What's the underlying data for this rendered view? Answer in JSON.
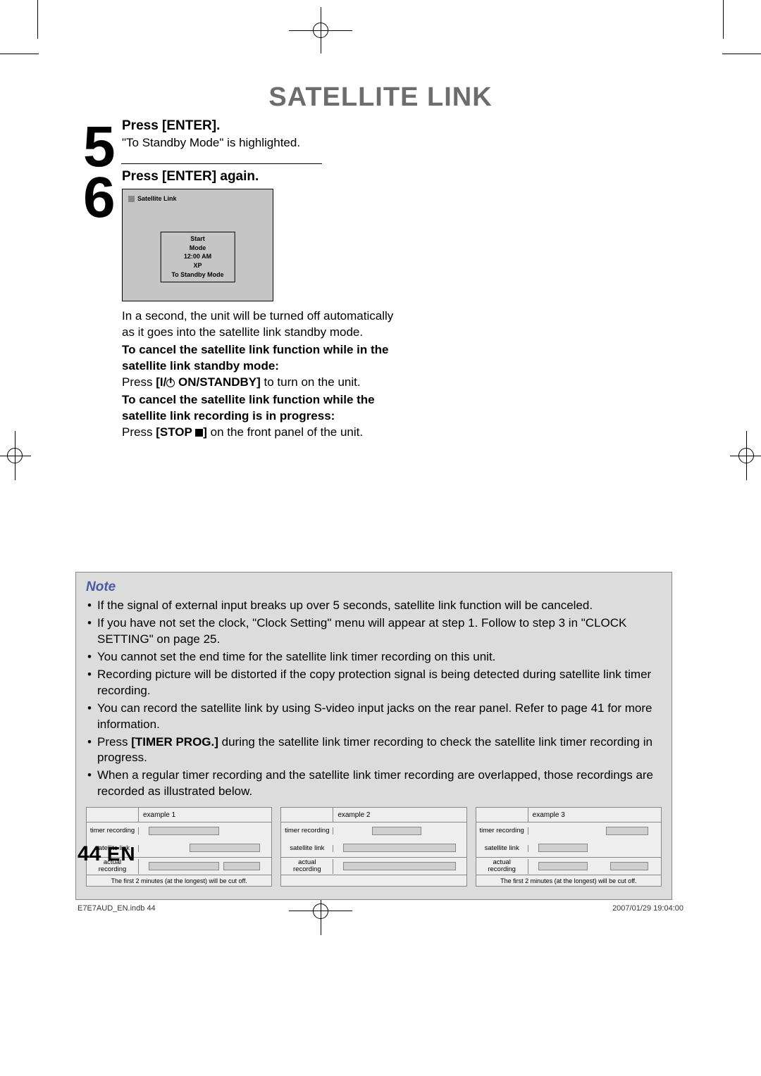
{
  "title": "SATELLITE LINK",
  "step5": {
    "num": "5",
    "head": "Press [ENTER].",
    "text": "\"To Standby Mode\" is highlighted."
  },
  "step6": {
    "num": "6",
    "head": "Press [ENTER] again.",
    "screen": {
      "title": "Satellite Link",
      "col1": "Start",
      "col2": "Mode",
      "val1": "12:00 AM",
      "val2": "XP",
      "row3": "To Standby Mode"
    },
    "p1": "In a second, the unit will be turned off automatically as it goes into the satellite link standby mode.",
    "b1": "To cancel the satellite link function while in the satellite link standby mode:",
    "p2a": "Press ",
    "p2b": "[I/",
    "p2c": " ON/STANDBY]",
    "p2d": " to turn on the unit.",
    "b2": "To cancel the satellite link function while the satellite link recording is in progress:",
    "p3a": "Press ",
    "p3b": "[STOP ",
    "p3c": "]",
    "p3d": " on the front panel of the unit."
  },
  "note": {
    "title": "Note",
    "items": [
      "If the signal of external input breaks up over 5 seconds, satellite link function will be canceled.",
      "If you have not set the clock, \"Clock Setting\" menu will appear at step 1. Follow to step 3 in \"CLOCK SETTING\" on page 25.",
      "You cannot set the end time for the satellite link timer recording on this unit.",
      "Recording picture will be distorted if the copy protection signal is being detected during satellite link timer recording.",
      "You can record the satellite link by using S-video input jacks on the rear panel. Refer to page 41 for more information.",
      "Press [TIMER PROG.] during the satellite link timer recording to check the satellite link timer recording in progress.",
      "When a regular timer recording and the satellite link timer recording are overlapped, those recordings are recorded as illustrated below."
    ],
    "timer_prog": "[TIMER PROG.]",
    "examples": {
      "labels": {
        "timer": "timer recording",
        "sat": "satellite link",
        "actual": "actual recording"
      },
      "ex": [
        "example 1",
        "example 2",
        "example 3"
      ],
      "foot1": "The first 2 minutes (at the longest) will be cut off.",
      "foot3": "The first 2 minutes (at the longest) will be cut off."
    }
  },
  "page_num": "44",
  "page_lang": "EN",
  "footer_l": "E7E7AUD_EN.indb   44",
  "footer_r": "2007/01/29   19:04:00"
}
